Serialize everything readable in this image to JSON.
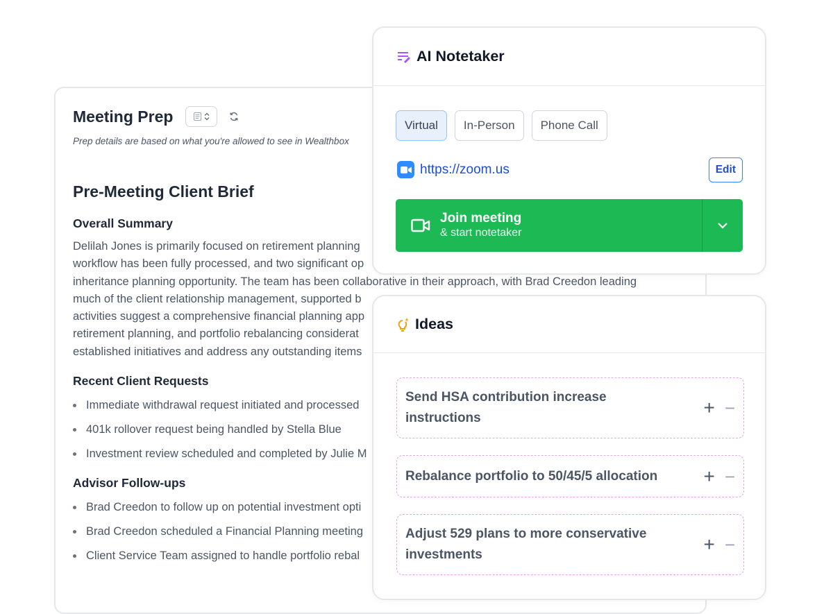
{
  "prep": {
    "title": "Meeting Prep",
    "note": "Prep details are based on what you're allowed to see in Wealthbox",
    "brief_title": "Pre-Meeting Client Brief",
    "summary_heading": "Overall Summary",
    "summary_lines": [
      "Delilah Jones is primarily focused on retirement planning",
      "workflow has been fully processed, and two significant op",
      "inheritance planning opportunity. The team has been collaborative in their approach, with Brad Creedon leading",
      "much of the client relationship management, supported b",
      "activities suggest a comprehensive financial planning app",
      "retirement planning, and portfolio rebalancing considerat",
      "established initiatives and address any outstanding items"
    ],
    "requests_heading": "Recent Client Requests",
    "requests": [
      "Immediate withdrawal request initiated and processed",
      "401k rollover request being handled by Stella Blue",
      "Investment review scheduled and completed by Julie M"
    ],
    "followups_heading": "Advisor Follow-ups",
    "followups": [
      "Brad Creedon to follow up on potential investment opti",
      "Brad Creedon scheduled a Financial Planning meeting",
      "Client Service Team assigned to handle portfolio rebal"
    ]
  },
  "notetaker": {
    "title": "AI Notetaker",
    "icon": "notetaker-icon",
    "modes": [
      "Virtual",
      "In-Person",
      "Phone Call"
    ],
    "active_mode": "Virtual",
    "meeting_link": "https://zoom.us",
    "edit_label": "Edit",
    "join_title": "Join meeting",
    "join_subtitle": "& start notetaker",
    "colors": {
      "join_green": "#1db954",
      "link_blue": "#1d4ed8",
      "accent_purple": "#a855f7"
    }
  },
  "ideas": {
    "title": "Ideas",
    "icon": "lightbulb-icon",
    "items": [
      {
        "lines": [
          "Send HSA contribution increase",
          "instructions"
        ]
      },
      {
        "lines": [
          "Rebalance portfolio to 50/45/5 allocation"
        ]
      },
      {
        "lines": [
          "Adjust 529 plans to more conservative",
          "investments"
        ]
      }
    ],
    "add_symbol": "+",
    "remove_symbol": "−"
  }
}
